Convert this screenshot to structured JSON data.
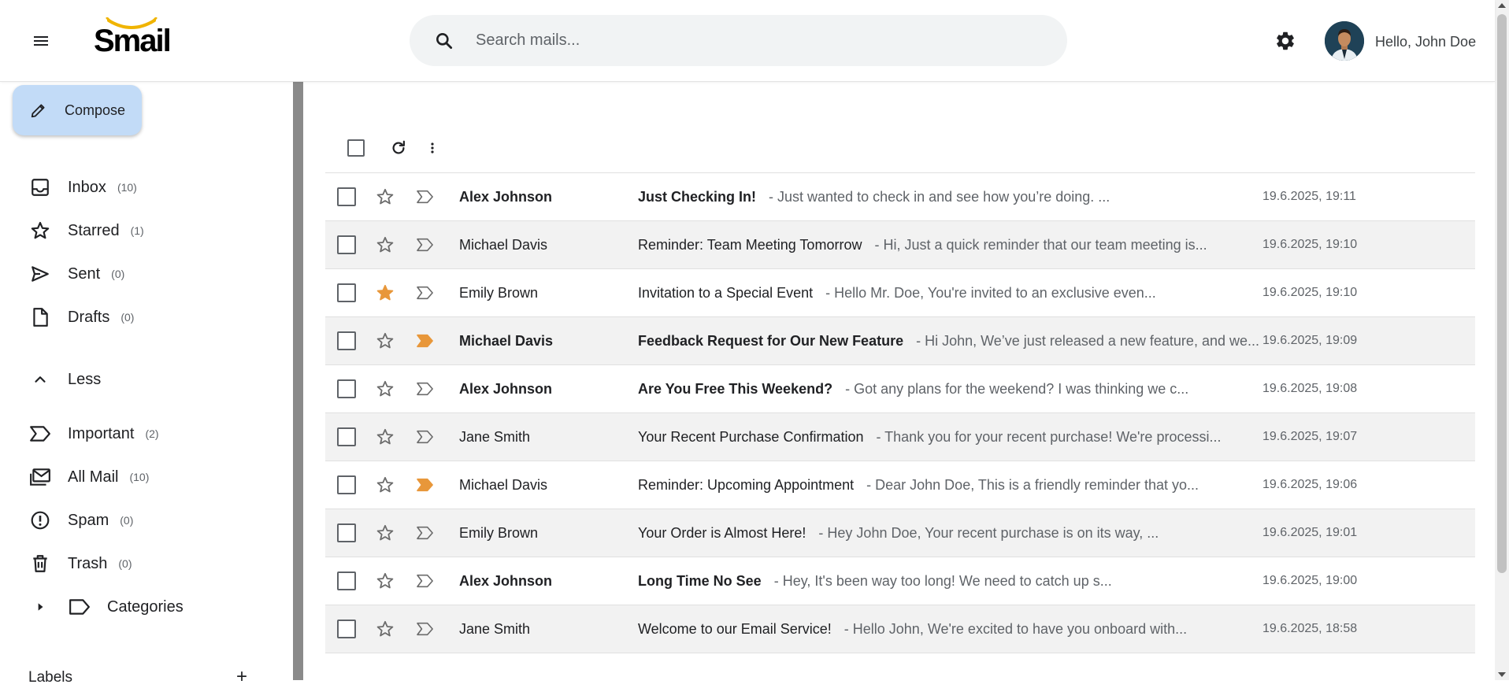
{
  "app": {
    "logo_text": "Smail"
  },
  "header": {
    "search_placeholder": "Search mails...",
    "greeting": "Hello, John Doe"
  },
  "sidebar": {
    "compose_label": "Compose",
    "items": [
      {
        "label": "Inbox",
        "count": "(10)",
        "icon": "inbox-icon"
      },
      {
        "label": "Starred",
        "count": "(1)",
        "icon": "star-icon"
      },
      {
        "label": "Sent",
        "count": "(0)",
        "icon": "send-icon"
      },
      {
        "label": "Drafts",
        "count": "(0)",
        "icon": "draft-icon"
      }
    ],
    "less_label": "Less",
    "more_items": [
      {
        "label": "Important",
        "count": "(2)",
        "icon": "important-icon"
      },
      {
        "label": "All Mail",
        "count": "(10)",
        "icon": "all-mail-icon"
      },
      {
        "label": "Spam",
        "count": "(0)",
        "icon": "spam-icon"
      },
      {
        "label": "Trash",
        "count": "(0)",
        "icon": "trash-icon"
      }
    ],
    "categories_label": "Categories",
    "labels_heading": "Labels",
    "labels_add": "+"
  },
  "colors": {
    "accent_orange": "#e8973a",
    "compose_bg": "#c2dbf7",
    "row_alt": "#f2f2f2"
  },
  "emails": [
    {
      "sender": "Alex Johnson",
      "subject": "Just Checking In!",
      "snippet": "- Just wanted to check in and see how you’re doing. ...",
      "date": "19.6.2025, 19:11",
      "unread": true,
      "starred": false,
      "important": false
    },
    {
      "sender": "Michael Davis",
      "subject": "Reminder: Team Meeting Tomorrow",
      "snippet": "- Hi, Just a quick reminder that our team meeting is...",
      "date": "19.6.2025, 19:10",
      "unread": false,
      "starred": false,
      "important": false
    },
    {
      "sender": "Emily Brown",
      "subject": "Invitation to a Special Event",
      "snippet": "- Hello Mr. Doe, You're invited to an exclusive even...",
      "date": "19.6.2025, 19:10",
      "unread": false,
      "starred": true,
      "important": false
    },
    {
      "sender": "Michael Davis",
      "subject": "Feedback Request for Our New Feature",
      "snippet": "- Hi John, We’ve just released a new feature, and we...",
      "date": "19.6.2025, 19:09",
      "unread": true,
      "starred": false,
      "important": true
    },
    {
      "sender": "Alex Johnson",
      "subject": "Are You Free This Weekend?",
      "snippet": "- Got any plans for the weekend? I was thinking we c...",
      "date": "19.6.2025, 19:08",
      "unread": true,
      "starred": false,
      "important": false
    },
    {
      "sender": "Jane Smith",
      "subject": "Your Recent Purchase Confirmation",
      "snippet": "- Thank you for your recent purchase! We're processi...",
      "date": "19.6.2025, 19:07",
      "unread": false,
      "starred": false,
      "important": false
    },
    {
      "sender": "Michael Davis",
      "subject": "Reminder: Upcoming Appointment",
      "snippet": "- Dear John Doe, This is a friendly reminder that yo...",
      "date": "19.6.2025, 19:06",
      "unread": false,
      "starred": false,
      "important": true
    },
    {
      "sender": "Emily Brown",
      "subject": "Your Order is Almost Here!",
      "snippet": "- Hey John Doe, Your recent purchase is on its way, ...",
      "date": "19.6.2025, 19:01",
      "unread": false,
      "starred": false,
      "important": false
    },
    {
      "sender": "Alex Johnson",
      "subject": "Long Time No See",
      "snippet": "- Hey, It's been way too long! We need to catch up s...",
      "date": "19.6.2025, 19:00",
      "unread": true,
      "starred": false,
      "important": false
    },
    {
      "sender": "Jane Smith",
      "subject": "Welcome to our Email Service!",
      "snippet": "- Hello John, We're excited to have you onboard with...",
      "date": "19.6.2025, 18:58",
      "unread": false,
      "starred": false,
      "important": false
    }
  ]
}
